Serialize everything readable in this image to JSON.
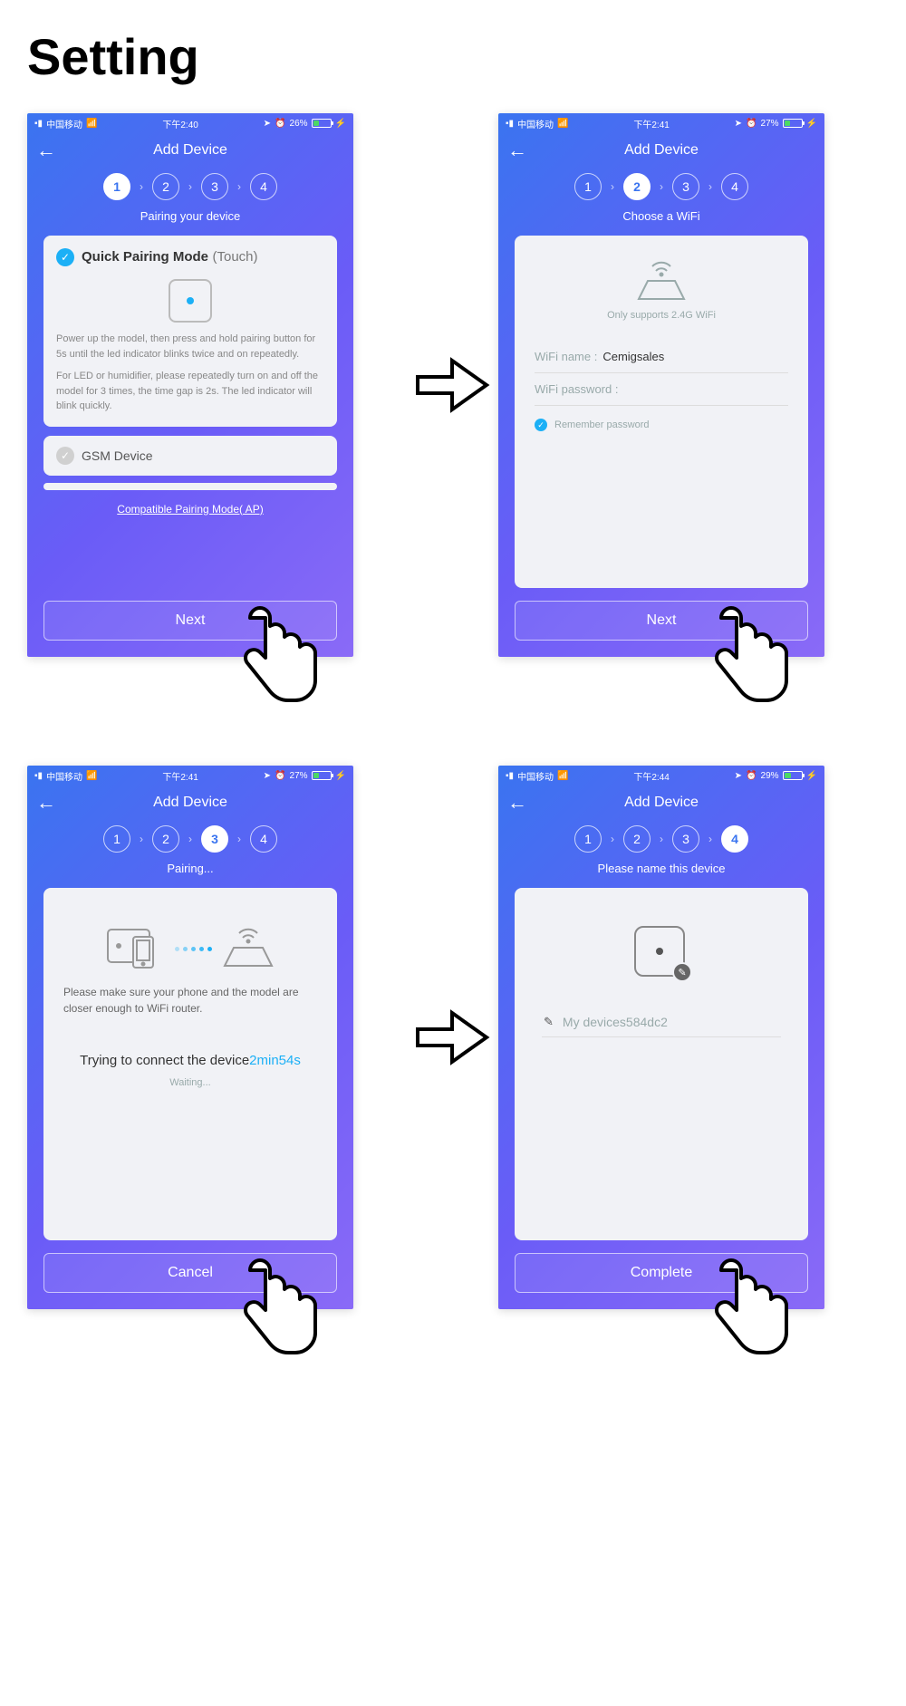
{
  "page_title": "Setting",
  "common": {
    "carrier_signal": "▪▮",
    "nav_title": "Add Device",
    "back_glyph": "←"
  },
  "screen1": {
    "carrier": "中国移动",
    "time": "下午2:40",
    "battery_pct": "26%",
    "active_step": 1,
    "subtitle": "Pairing your device",
    "mode_title_strong": "Quick Pairing Mode",
    "mode_title_sub": "(Touch)",
    "help1": "Power up the model, then press and hold pairing button for 5s until the led indicator blinks twice and on repeatedly.",
    "help2": "For LED or humidifier, please repeatedly turn on and off the model for 3 times, the time gap is 2s. The led indicator will blink quickly.",
    "gsm_label": "GSM Device",
    "compat_link": "Compatible Pairing Mode( AP)",
    "button": "Next"
  },
  "screen2": {
    "carrier": "中国移动",
    "time": "下午2:41",
    "battery_pct": "27%",
    "active_step": 2,
    "subtitle": "Choose a WiFi",
    "supports": "Only supports 2.4G WiFi",
    "wifi_name_label": "WiFi name :",
    "wifi_name_value": "Cemigsales",
    "wifi_pass_label": "WiFi password :",
    "remember": "Remember password",
    "button": "Next"
  },
  "screen3": {
    "carrier": "中国移动",
    "time": "下午2:41",
    "battery_pct": "27%",
    "active_step": 3,
    "subtitle": "Pairing...",
    "note": "Please make sure your phone and the model are closer enough to WiFi router.",
    "trying_label": "Trying to connect the device",
    "trying_time": "2min54s",
    "waiting": "Waiting...",
    "button": "Cancel"
  },
  "screen4": {
    "carrier": "中国移动",
    "time": "下午2:44",
    "battery_pct": "29%",
    "active_step": 4,
    "subtitle": "Please name this device",
    "device_name": "My devices584dc2",
    "button": "Complete"
  }
}
